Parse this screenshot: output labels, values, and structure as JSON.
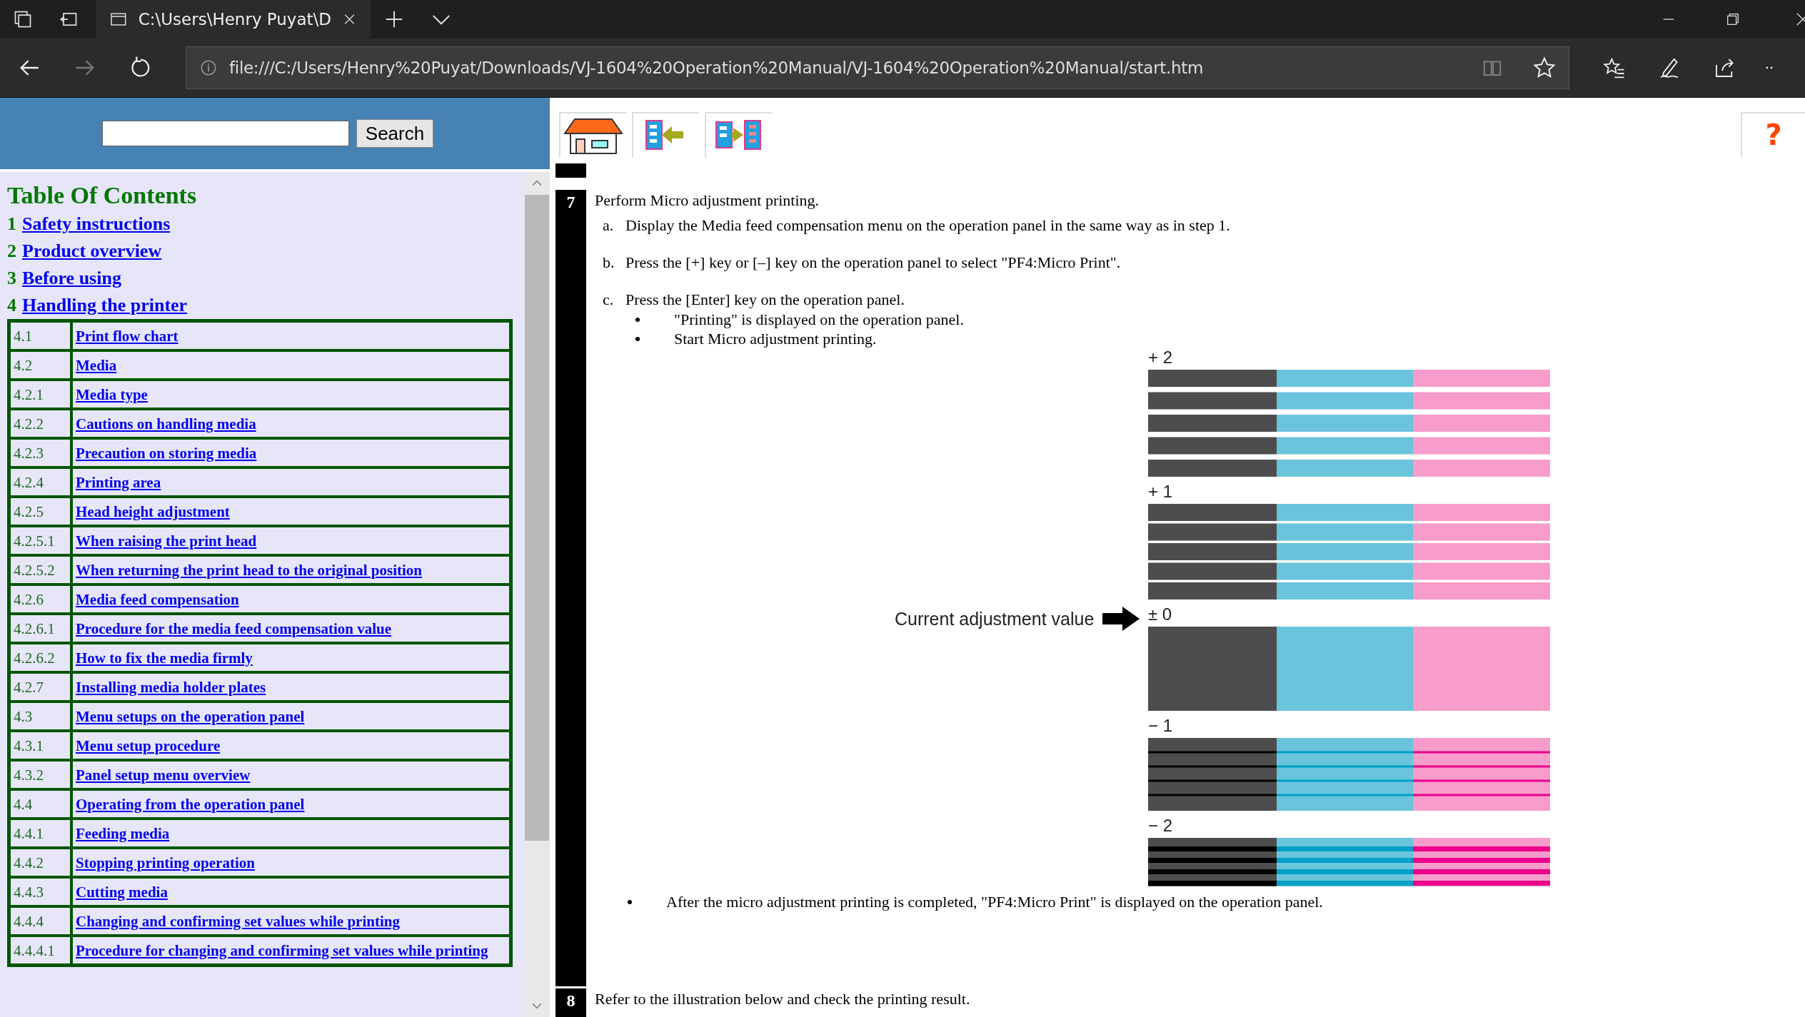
{
  "browser": {
    "tab_title": "C:\\Users\\Henry Puyat\\D",
    "url": "file:///C:/Users/Henry%20Puyat/Downloads/VJ-1604%20Operation%20Manual/VJ-1604%20Operation%20Manual/start.htm"
  },
  "search": {
    "button": "Search"
  },
  "toc": {
    "title": "Table Of Contents",
    "chapters": [
      {
        "number": "1",
        "title": "Safety instructions"
      },
      {
        "number": "2",
        "title": "Product overview"
      },
      {
        "number": "3",
        "title": "Before using"
      },
      {
        "number": "4",
        "title": "Handling the printer"
      }
    ],
    "sections": [
      {
        "number": "4.1",
        "title": "Print flow chart"
      },
      {
        "number": "4.2",
        "title": "Media"
      },
      {
        "number": "4.2.1",
        "title": "Media type"
      },
      {
        "number": "4.2.2",
        "title": "Cautions on handling media"
      },
      {
        "number": "4.2.3",
        "title": "Precaution on storing media"
      },
      {
        "number": "4.2.4",
        "title": "Printing area"
      },
      {
        "number": "4.2.5",
        "title": "Head height adjustment"
      },
      {
        "number": "4.2.5.1",
        "title": "When raising the print head"
      },
      {
        "number": "4.2.5.2",
        "title": "When returning the print head to the original position"
      },
      {
        "number": "4.2.6",
        "title": "Media feed compensation"
      },
      {
        "number": "4.2.6.1",
        "title": "Procedure for the media feed compensation value"
      },
      {
        "number": "4.2.6.2",
        "title": "How to fix the media firmly"
      },
      {
        "number": "4.2.7",
        "title": "Installing media holder plates"
      },
      {
        "number": "4.3",
        "title": "Menu setups on the operation panel"
      },
      {
        "number": "4.3.1",
        "title": "Menu setup procedure"
      },
      {
        "number": "4.3.2",
        "title": "Panel setup menu overview"
      },
      {
        "number": "4.4",
        "title": "Operating from the operation panel"
      },
      {
        "number": "4.4.1",
        "title": "Feeding media"
      },
      {
        "number": "4.4.2",
        "title": "Stopping printing operation"
      },
      {
        "number": "4.4.3",
        "title": "Cutting media"
      },
      {
        "number": "4.4.4",
        "title": "Changing and confirming set values while printing"
      },
      {
        "number": "4.4.4.1",
        "title": "Procedure for changing and confirming set values while printing"
      }
    ]
  },
  "help_button": "?",
  "step": {
    "number": "7",
    "text": "Perform Micro adjustment printing.",
    "substeps": [
      {
        "marker": "a.",
        "text": "Display the Media feed compensation menu on the operation panel in the same way as in step 1."
      },
      {
        "marker": "b.",
        "text": "Press the [+] key or [–] key on the operation panel to select \"PF4:Micro Print\"."
      },
      {
        "marker": "c.",
        "text": "Press the [Enter] key on the operation panel.",
        "bullets": [
          "\"Printing\" is displayed on the operation panel.",
          "Start Micro adjustment printing."
        ]
      }
    ],
    "figure": {
      "callout": "Current adjustment value",
      "groups": [
        {
          "label": "+ 2",
          "kind": "gap_wide"
        },
        {
          "label": "+ 1",
          "kind": "gap_narrow"
        },
        {
          "label": "± 0",
          "kind": "solid"
        },
        {
          "label": "− 1",
          "kind": "overlap_thin"
        },
        {
          "label": "− 2",
          "kind": "overlap_thick"
        }
      ]
    },
    "after_bullet": "After the micro adjustment printing is completed, \"PF4:Micro Print\" is displayed on the operation panel."
  },
  "next_step": {
    "number": "8",
    "text": "Refer to the illustration below and check the printing result."
  }
}
